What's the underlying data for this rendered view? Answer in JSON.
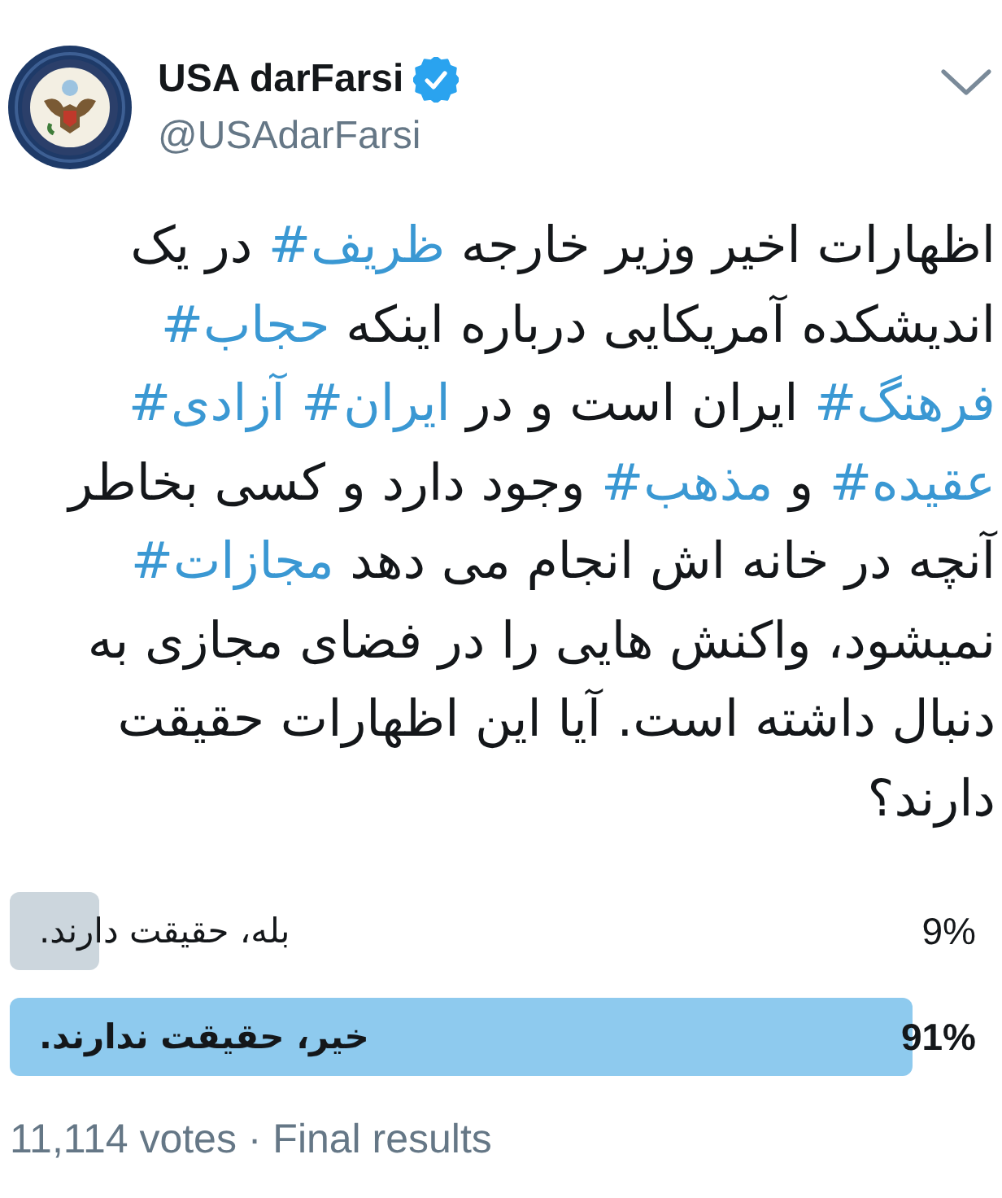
{
  "tweet": {
    "author": {
      "name": "USA darFarsi",
      "verified": true,
      "handle": "@USAdarFarsi"
    },
    "text": [
      {
        "kind": "text",
        "text": "اظهارات اخیر وزیر خارجه"
      },
      {
        "kind": "hashtag",
        "text": "#ظریف"
      },
      {
        "kind": "text",
        "text": "در یک اندیشکده آمریکایی درباره اینکه"
      },
      {
        "kind": "hashtag",
        "text": "#حجاب"
      },
      {
        "kind": "hashtag",
        "text": "#فرهنگ"
      },
      {
        "kind": "text",
        "text": "ایران است و در"
      },
      {
        "kind": "hashtag",
        "text": "#ایران"
      },
      {
        "kind": "hashtag",
        "text": "#آزادی"
      },
      {
        "kind": "hashtag",
        "text": "#عقیده"
      },
      {
        "kind": "text",
        "text": "و"
      },
      {
        "kind": "hashtag",
        "text": "#مذهب"
      },
      {
        "kind": "text",
        "text": "وجود دارد و کسی بخاطر آنچه در خانه اش انجام می دهد"
      },
      {
        "kind": "hashtag",
        "text": "#مجازات"
      },
      {
        "kind": "text",
        "text": "نمیشود، واکنش هایی را در فضای مجازی به دنبال داشته است. آیا این اظهارات حقیقت دارند؟"
      }
    ],
    "poll": {
      "options": [
        {
          "label": "بله، حقیقت دارند.",
          "percent": "9%",
          "level": 0.09,
          "leading": false
        },
        {
          "label": "خیر، حقیقت ندارند.",
          "percent": "91%",
          "level": 0.91,
          "leading": true
        }
      ],
      "footer": "11,114 votes · Final results"
    }
  }
}
